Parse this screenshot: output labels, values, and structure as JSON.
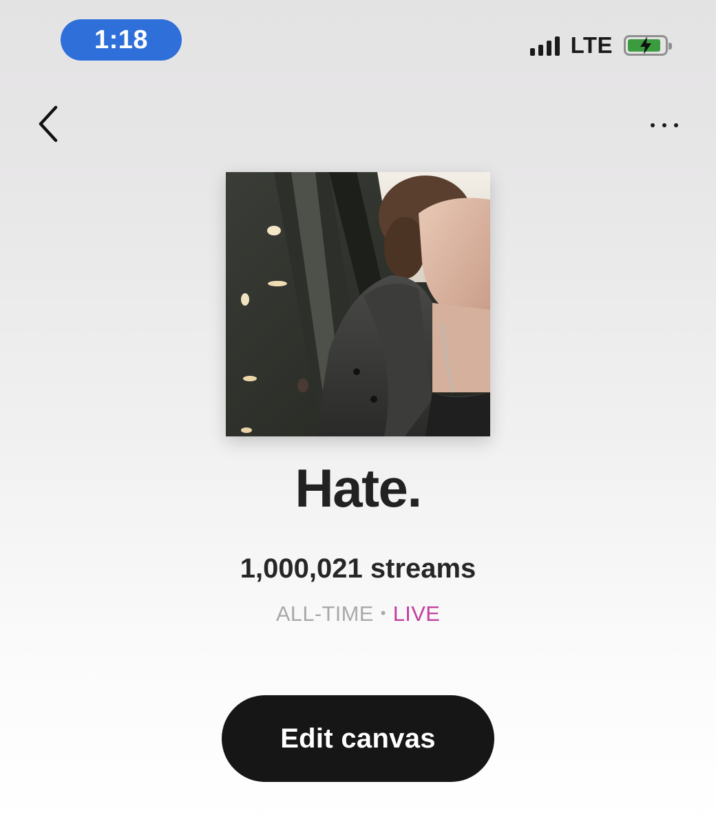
{
  "status_bar": {
    "time": "1:18",
    "network": "LTE",
    "signal_bars": 4,
    "battery_level": 0.9,
    "charging": true,
    "colors": {
      "time_pill": "#2e6fd9",
      "battery_fill": "#3a9b3f"
    }
  },
  "nav": {
    "back_icon": "chevron-left-icon",
    "more_icon": "more-horizontal-icon"
  },
  "track": {
    "title": "Hate.",
    "streams": "1,000,021 streams",
    "period_label": "ALL-TIME",
    "period_separator": "•",
    "live_label": "LIVE",
    "live_color": "#c23fa0"
  },
  "actions": {
    "edit_canvas_label": "Edit canvas"
  }
}
